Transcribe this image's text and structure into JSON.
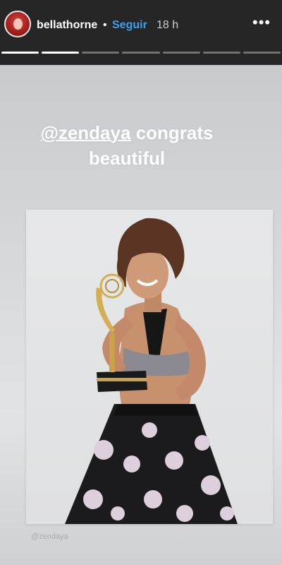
{
  "header": {
    "username": "bellathorne",
    "separator": "•",
    "follow_label": "Seguir",
    "time": "18 h",
    "more_label": "•••"
  },
  "progress": {
    "segments": 7,
    "completed": 2
  },
  "story": {
    "caption_mention": "@zendaya",
    "caption_rest": "congrats",
    "caption_line2": "beautiful",
    "photo_watermark": "@zendaya"
  },
  "colors": {
    "header_bg": "#262626",
    "follow_blue": "#3aa0f0",
    "story_bg": "#d8dadc"
  }
}
